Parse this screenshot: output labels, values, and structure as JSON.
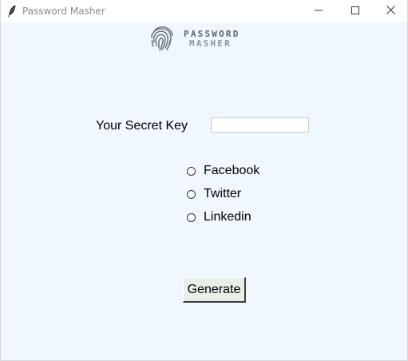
{
  "window": {
    "title": "Password Masher",
    "app_icon": "feather-icon",
    "controls": {
      "minimize_icon": "minimize-icon",
      "maximize_icon": "maximize-icon",
      "close_icon": "close-icon"
    }
  },
  "logo": {
    "icon": "fingerprint-icon",
    "line1": "PASSWORD",
    "line2": "MASHER"
  },
  "form": {
    "secret_key_label": "Your Secret Key",
    "secret_key_value": "",
    "platforms": [
      {
        "label": "Facebook",
        "selected": false
      },
      {
        "label": "Twitter",
        "selected": false
      },
      {
        "label": "Linkedin",
        "selected": false
      }
    ],
    "generate_label": "Generate"
  },
  "colors": {
    "window_background": "#f0f7ff",
    "titlebar_background": "#ffffff",
    "button_background": "#e8efe8"
  }
}
